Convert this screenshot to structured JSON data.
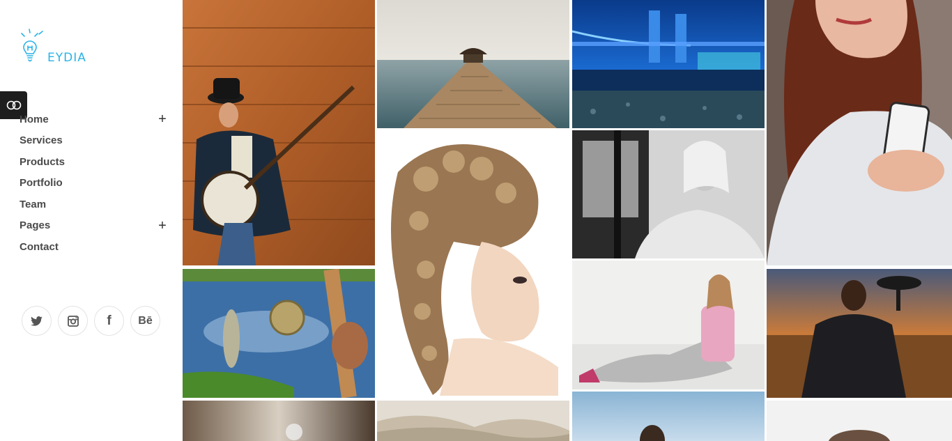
{
  "brand": {
    "logo_text": "EYDIA",
    "accent_color": "#2bb3e6"
  },
  "toggle": {
    "icon": "toggle-icon"
  },
  "nav": {
    "items": [
      {
        "label": "Home",
        "has_submenu": true,
        "expand_symbol": "+"
      },
      {
        "label": "Services",
        "has_submenu": false
      },
      {
        "label": "Products",
        "has_submenu": false
      },
      {
        "label": "Portfolio",
        "has_submenu": false
      },
      {
        "label": "Team",
        "has_submenu": false
      },
      {
        "label": "Pages",
        "has_submenu": true,
        "expand_symbol": "+"
      },
      {
        "label": "Contact",
        "has_submenu": false
      }
    ]
  },
  "socials": [
    {
      "icon": "twitter-icon"
    },
    {
      "icon": "instagram-icon"
    },
    {
      "icon": "facebook-icon",
      "glyph": "f"
    },
    {
      "icon": "behance-icon",
      "glyph": "Bē"
    }
  ],
  "gallery": {
    "tiles": [
      {
        "subject": "banjo-player"
      },
      {
        "subject": "pier"
      },
      {
        "subject": "tower-bridge"
      },
      {
        "subject": "woman-phone"
      },
      {
        "subject": "fishing-reel"
      },
      {
        "subject": "curly-hair"
      },
      {
        "subject": "woman-car"
      },
      {
        "subject": "woman-sitting"
      },
      {
        "subject": "man-savanna"
      },
      {
        "subject": "cafe"
      },
      {
        "subject": "desert"
      },
      {
        "subject": "sky-person"
      },
      {
        "subject": "portrait-bottom"
      }
    ]
  }
}
